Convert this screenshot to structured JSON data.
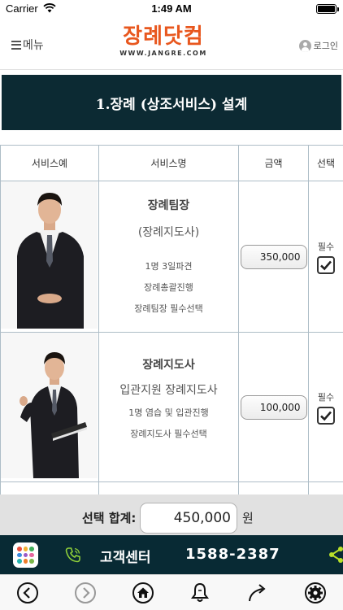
{
  "status_bar": {
    "carrier": "Carrier",
    "time": "1:49 AM"
  },
  "header": {
    "menu_label": "메뉴",
    "logo_text": "장례닷컴",
    "logo_url_text": "WWW.JANGRE.COM",
    "login_label": "로그인"
  },
  "section_title": "1.장례 (상조서비스) 설계",
  "table": {
    "columns": [
      "서비스예",
      "서비스명",
      "금액",
      "선택"
    ],
    "rows": [
      {
        "name": "장례팀장",
        "subtitle": "(장례지도사)",
        "details": [
          "1명 3일파견",
          "장례총괄진행",
          "장례팀장 필수선택"
        ],
        "price": "350,000",
        "requirement": "필수",
        "checked": true
      },
      {
        "name": "장례지도사",
        "subtitle": "입관지원 장례지도사",
        "details": [
          "1명 염습 및 입관진행",
          "장례지도사 필수선택"
        ],
        "price": "100,000",
        "requirement": "필수",
        "checked": true
      }
    ]
  },
  "total": {
    "label": "선택 합계:",
    "amount": "450,000",
    "unit": "원"
  },
  "customer_center": {
    "label": "고객센터",
    "phone": "1588-2387"
  },
  "colors": {
    "brand_orange": "#e8571e",
    "dark_navy": "#0c2a33",
    "table_border": "#aebdc7"
  },
  "icons": {
    "menu": "hamburger-icon",
    "login": "user-icon",
    "apps": "apps-grid-icon",
    "phone": "phone-icon",
    "share": "share-icon",
    "toolbar": [
      "back-icon",
      "forward-icon",
      "home-icon",
      "bell-icon",
      "redirect-icon",
      "settings-icon"
    ]
  }
}
